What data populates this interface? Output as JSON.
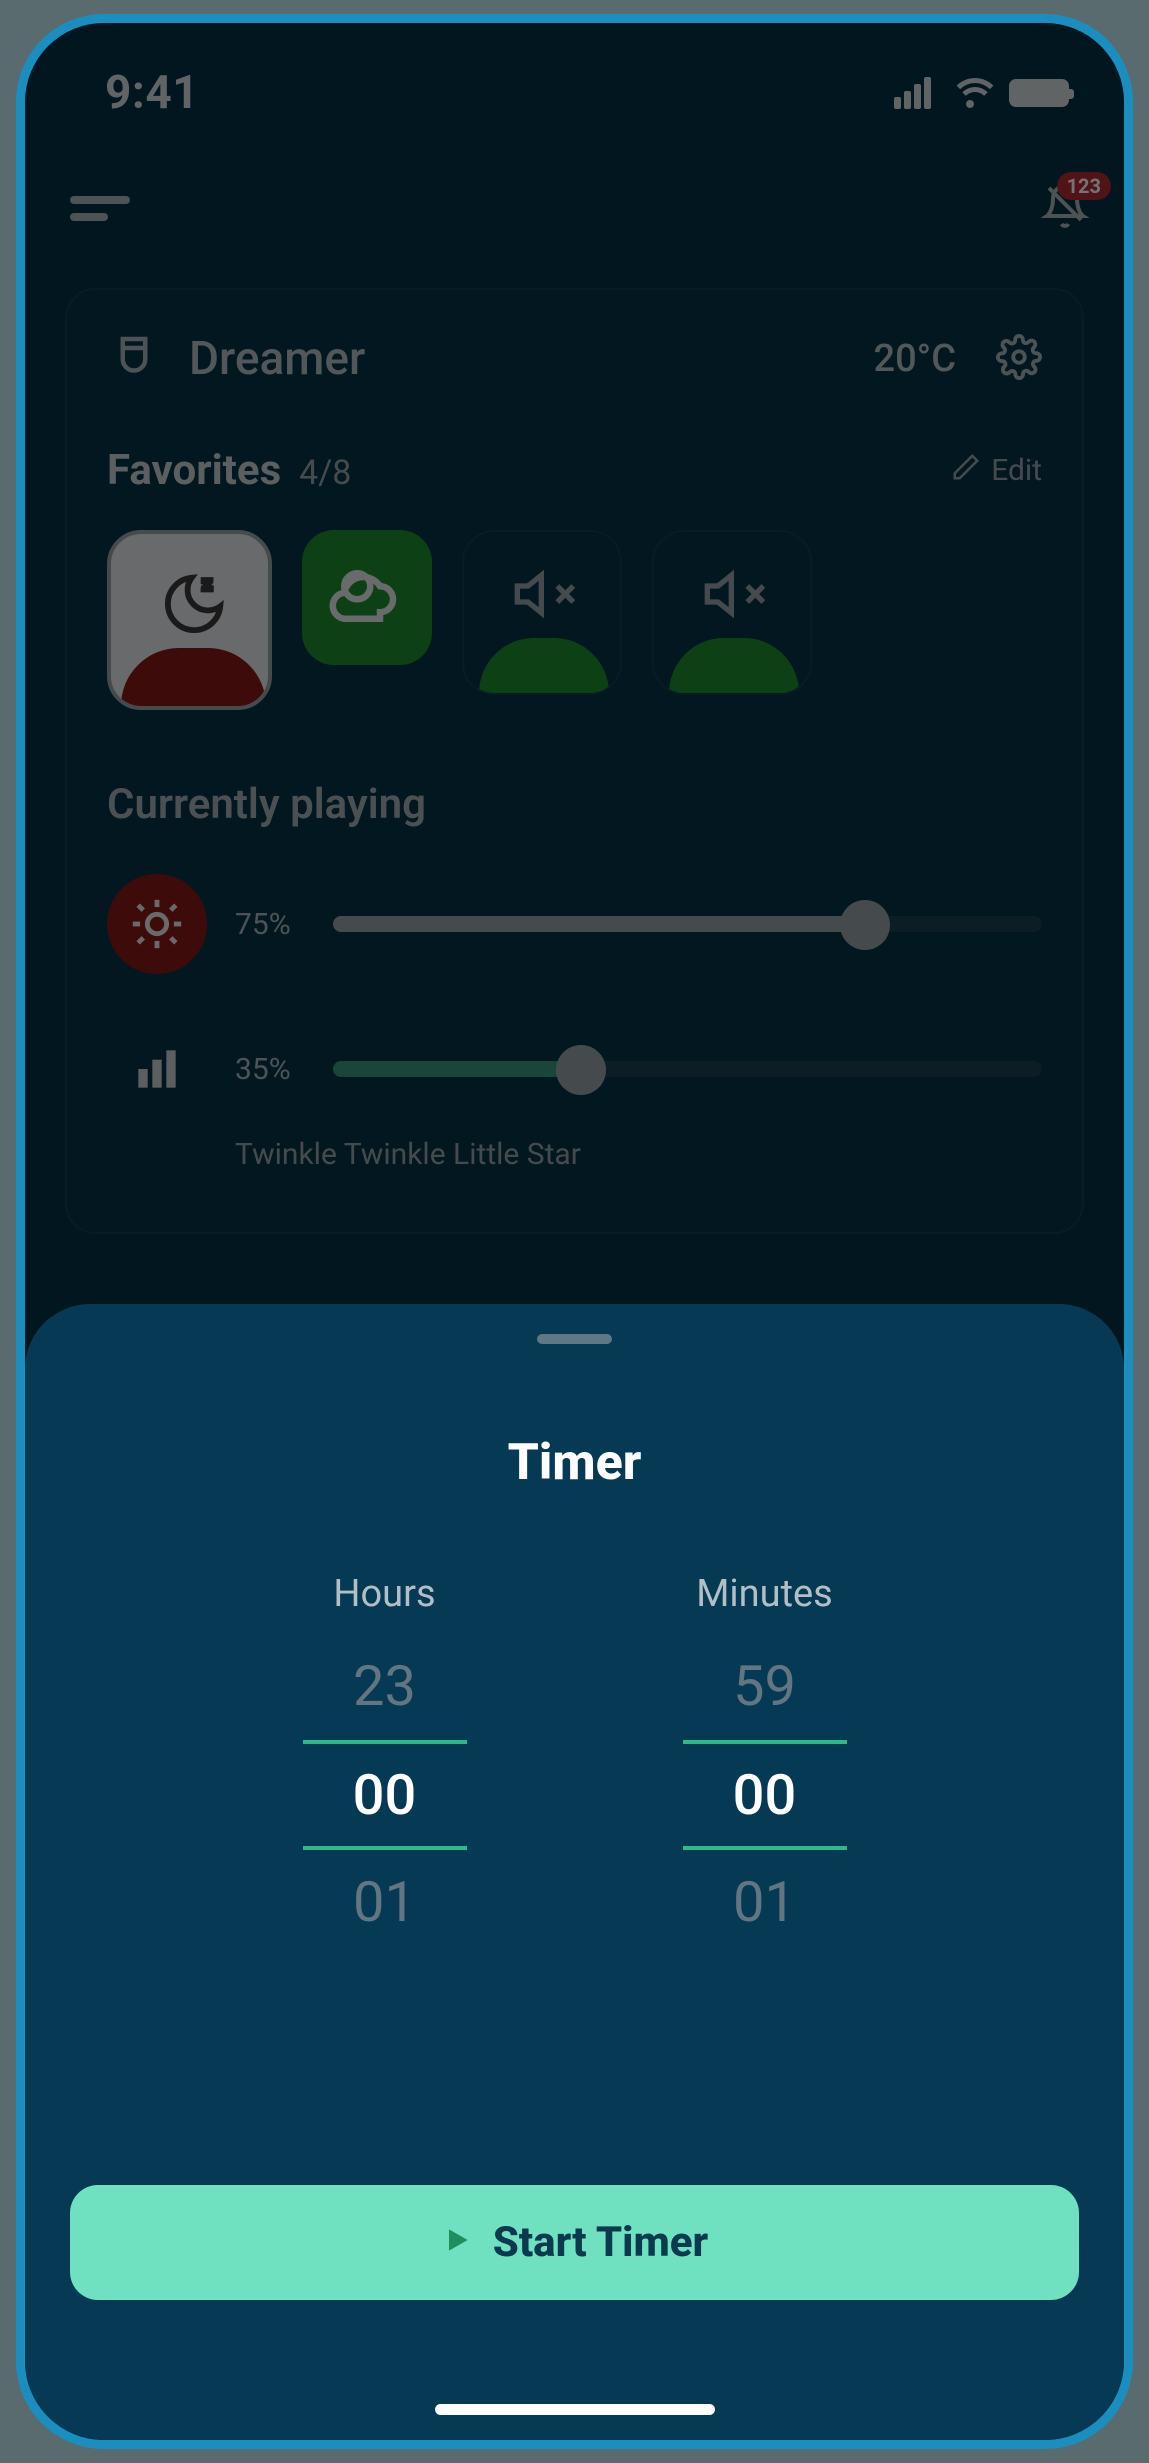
{
  "status": {
    "time": "9:41",
    "signal": 4,
    "wifi": true,
    "battery": 100
  },
  "header": {
    "notif_count": "123"
  },
  "device": {
    "name": "Dreamer",
    "temperature": "20°C"
  },
  "favorites": {
    "title": "Favorites",
    "count": "4/8",
    "edit_label": "Edit"
  },
  "currently_playing": {
    "title": "Currently playing",
    "brightness_pct": "75%",
    "brightness_value": 75,
    "volume_pct": "35%",
    "volume_value": 35,
    "song": "Twinkle Twinkle Little Star"
  },
  "timer_sheet": {
    "title": "Timer",
    "hours_label": "Hours",
    "minutes_label": "Minutes",
    "hours": {
      "prev": "23",
      "selected": "00",
      "next": "01"
    },
    "minutes": {
      "prev": "59",
      "selected": "00",
      "next": "01"
    },
    "start_label": "Start Timer"
  },
  "colors": {
    "accent": "#6fe0c0",
    "accent_dark": "#2fb88a"
  }
}
